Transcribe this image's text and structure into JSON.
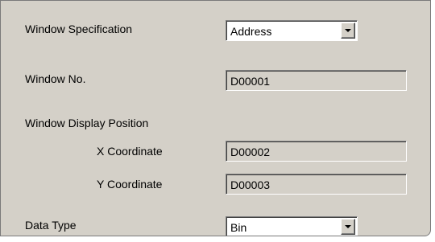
{
  "labels": {
    "window_specification": "Window Specification",
    "window_no": "Window No.",
    "window_display_position": "Window Display Position",
    "x_coordinate": "X Coordinate",
    "y_coordinate": "Y Coordinate",
    "data_type": "Data Type"
  },
  "fields": {
    "window_specification": {
      "selected": "Address"
    },
    "window_no": {
      "value": "D00001"
    },
    "x_coordinate": {
      "value": "D00002"
    },
    "y_coordinate": {
      "value": "D00003"
    },
    "data_type": {
      "selected": "Bin"
    }
  },
  "icons": {
    "dropdown": "chevron-down-icon"
  },
  "colors": {
    "panel_background": "#d4d0c8",
    "text": "#000000",
    "input_background": "#ffffff"
  }
}
